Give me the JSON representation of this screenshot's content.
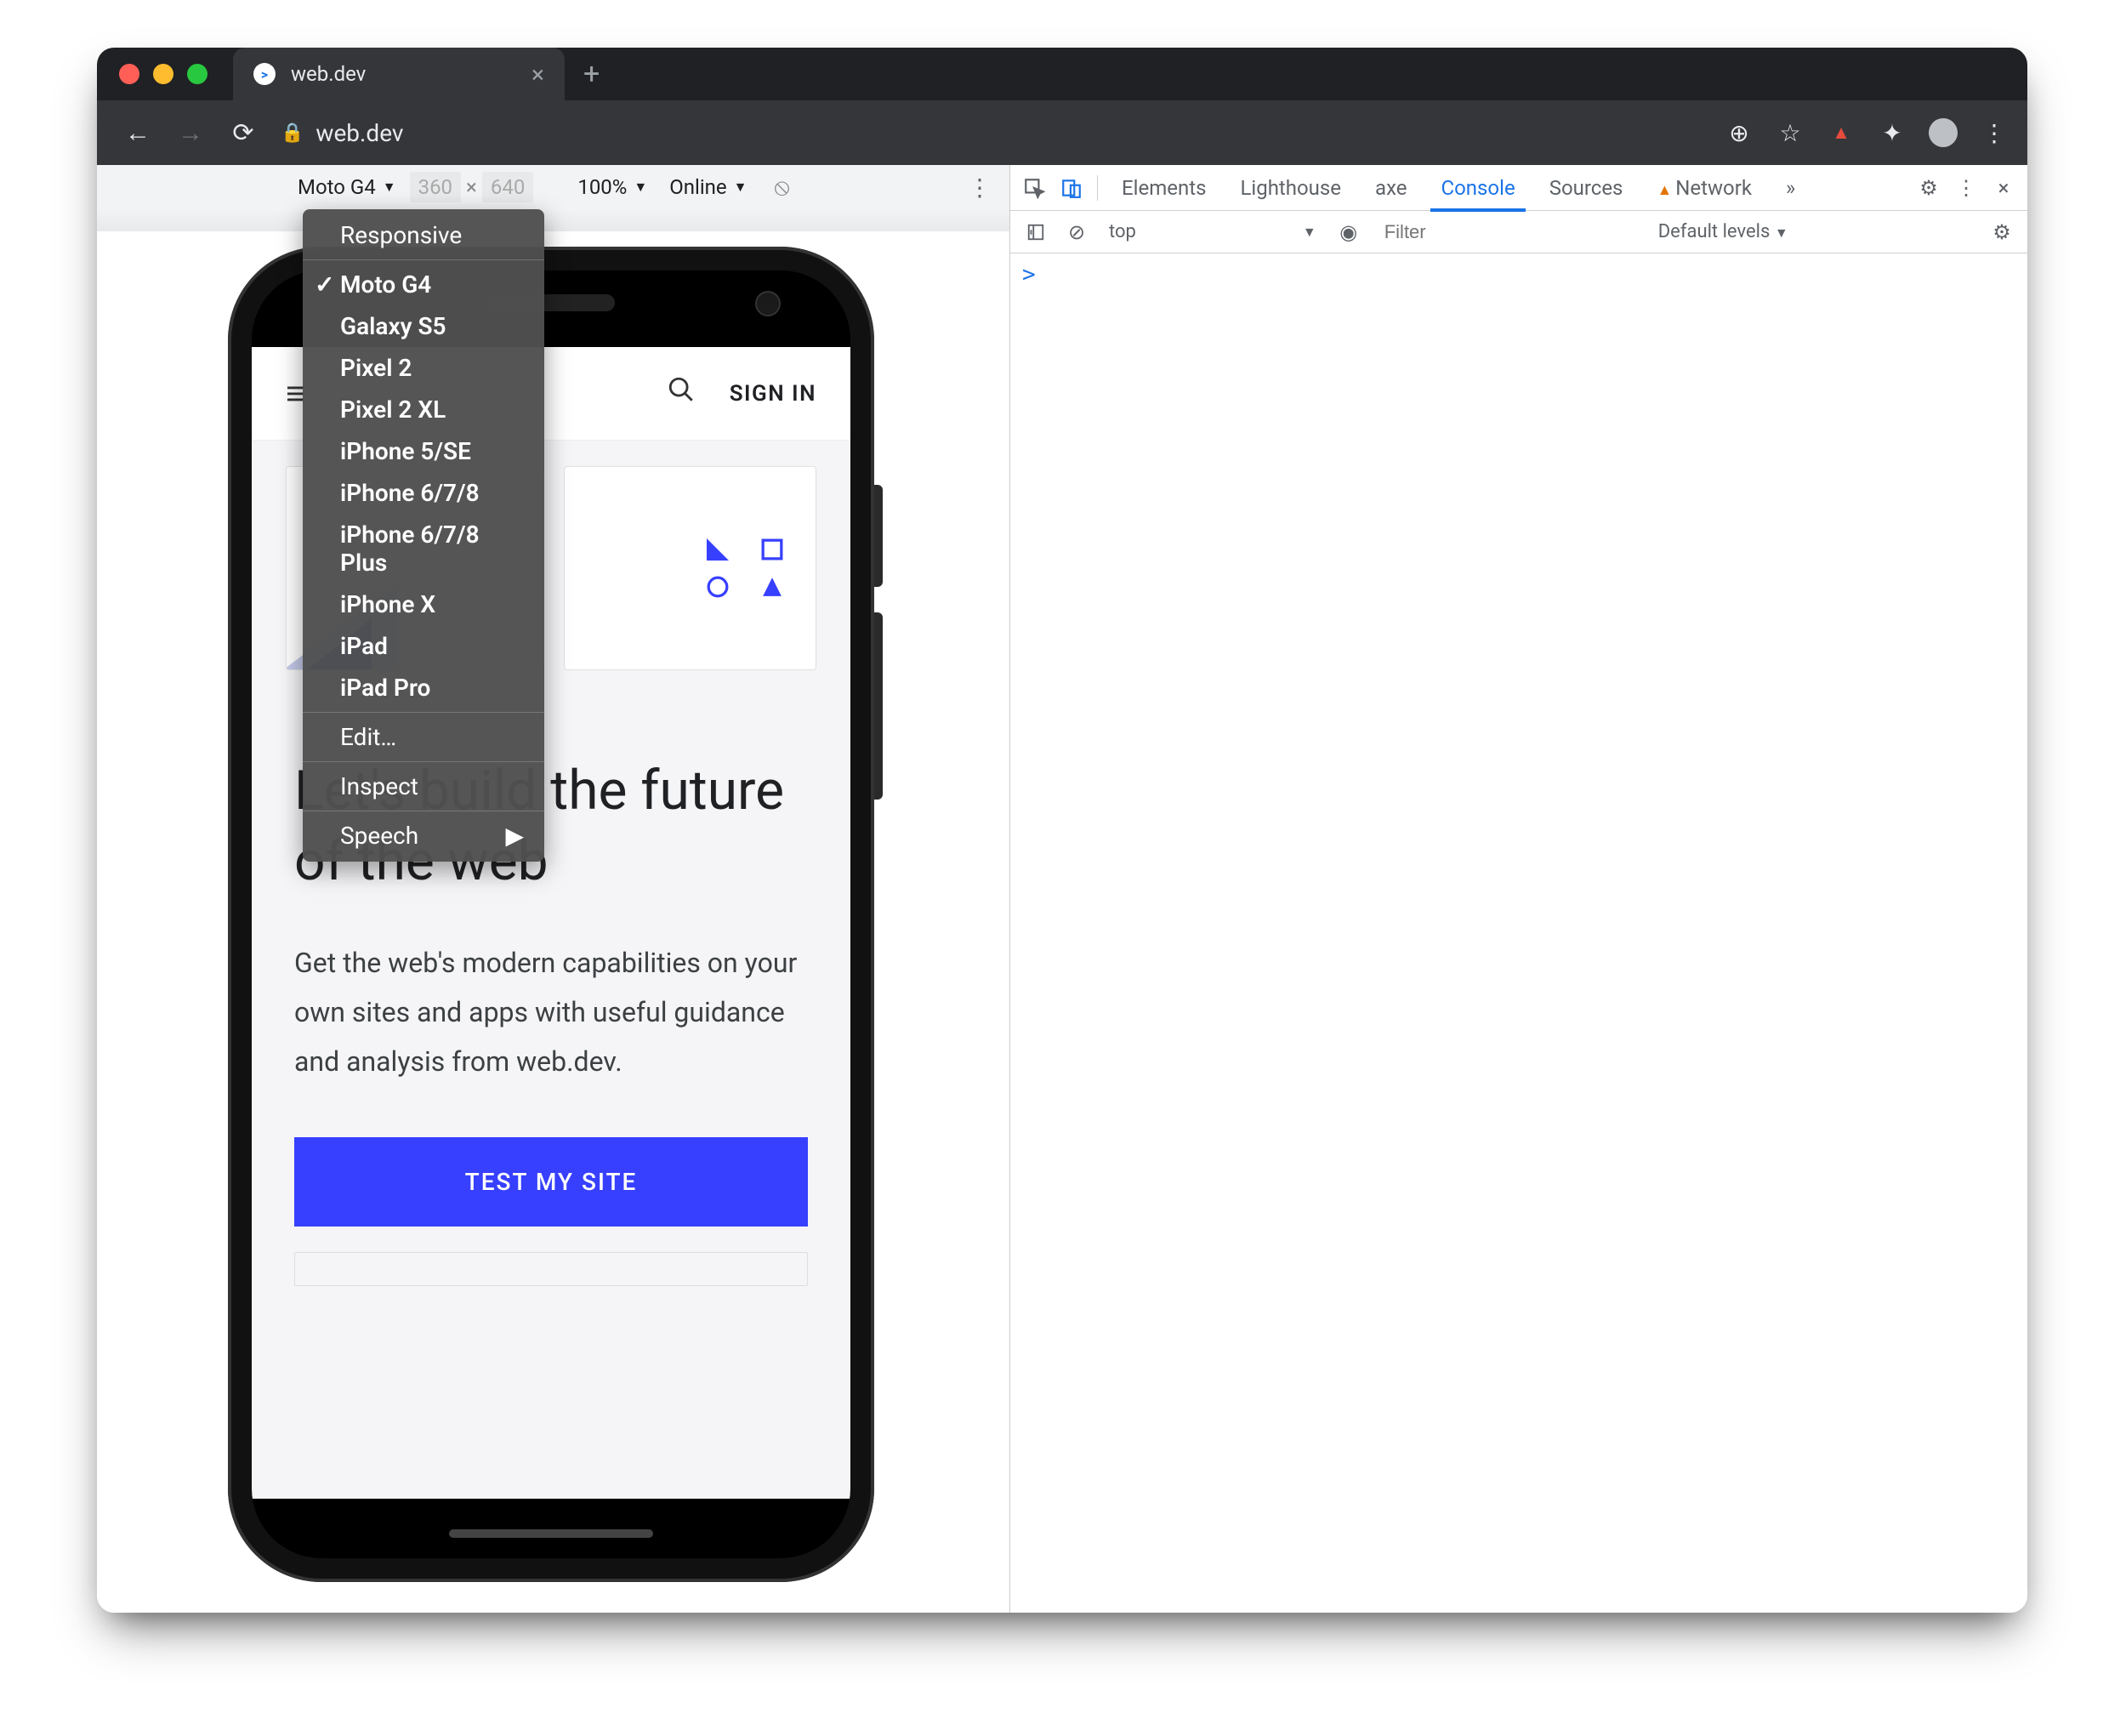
{
  "tab": {
    "title": "web.dev",
    "favicon_letter": ">"
  },
  "url_host": "web.dev",
  "device_toolbar": {
    "device": "Moto G4",
    "width": "360",
    "height": "640",
    "zoom": "100%",
    "throttling": "Online"
  },
  "device_menu": {
    "responsive": "Responsive",
    "devices": [
      "Moto G4",
      "Galaxy S5",
      "Pixel 2",
      "Pixel 2 XL",
      "iPhone 5/SE",
      "iPhone 6/7/8",
      "iPhone 6/7/8 Plus",
      "iPhone X",
      "iPad",
      "iPad Pro"
    ],
    "selected": "Moto G4",
    "edit": "Edit…",
    "inspect": "Inspect",
    "speech": "Speech"
  },
  "page": {
    "sign_in": "SIGN IN",
    "headline": "Let's build the future of the web",
    "subhead": "Get the web's modern capabilities on your own sites and apps with useful guidance and analysis from web.dev.",
    "cta": "TEST MY SITE"
  },
  "devtools": {
    "tabs": [
      "Elements",
      "Lighthouse",
      "axe",
      "Console",
      "Sources",
      "Network"
    ],
    "active": "Console",
    "more": "»",
    "context": "top",
    "filter_placeholder": "Filter",
    "levels": "Default levels",
    "prompt": ">"
  }
}
